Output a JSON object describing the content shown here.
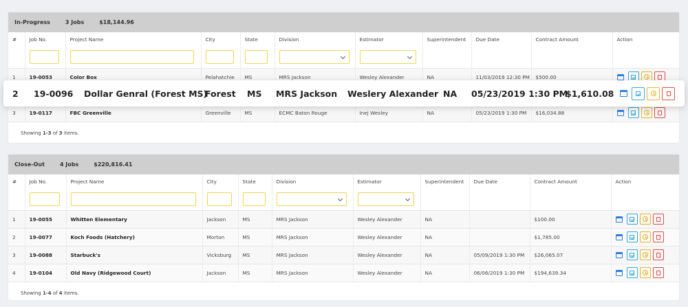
{
  "columns": [
    "#",
    "Job No.",
    "Project Name",
    "City",
    "State",
    "Division",
    "Estimator",
    "Superintendent",
    "Due Date",
    "Contract Amount",
    "Action"
  ],
  "in_progress": {
    "status": "In-Progress",
    "jobs": "3 Jobs",
    "total": "$18,144.96",
    "rows": [
      {
        "n": "1",
        "job": "19-0053",
        "project": "Color Box",
        "city": "Pelahatchie",
        "state": "MS",
        "division": "MRS Jackson",
        "estimator": "Wesley Alexander",
        "super": "NA",
        "due": "11/03/2019 12:30 PM",
        "amount": "$500.00"
      },
      {
        "n": "2",
        "job": "19-0096",
        "project": "Dollar Genral (Forest MS)",
        "city": "Forest",
        "state": "MS",
        "division": "MRS Jackson",
        "estimator": "Weslery Alexander",
        "super": "NA",
        "due": "05/23/2019 1:30 PM",
        "amount": "$1,610.08"
      },
      {
        "n": "3",
        "job": "19-0117",
        "project": "FBC Greenville",
        "city": "Greenville",
        "state": "MS",
        "division": "ECMC Baton Rouge",
        "estimator": "Inej Wesley",
        "super": "NA",
        "due": "05/23/2019 1:30 PM",
        "amount": "$16,034.88"
      }
    ],
    "showing": {
      "prefix": "Showing ",
      "range": "1-3",
      "mid": " of ",
      "count": "3",
      "suffix": " items."
    }
  },
  "close_out": {
    "status": "Close-Out",
    "jobs": "4 Jobs",
    "total": "$220,816.41",
    "rows": [
      {
        "n": "1",
        "job": "19-0055",
        "project": "Whitten Elementary",
        "city": "Jackson",
        "state": "MS",
        "division": "MRS Jackson",
        "estimator": "Wesley Alexander",
        "super": "NA",
        "due": "",
        "amount": "$100.00"
      },
      {
        "n": "2",
        "job": "19-0077",
        "project": "Koch Foods (Hatchery)",
        "city": "Morton",
        "state": "MS",
        "division": "MRS Jackson",
        "estimator": "Wesley Alexander",
        "super": "NA",
        "due": "",
        "amount": "$1,785.00"
      },
      {
        "n": "3",
        "job": "19-0088",
        "project": "Starbuck's",
        "city": "Vicksburg",
        "state": "MS",
        "division": "MRS Jackson",
        "estimator": "Wesley Alexander",
        "super": "NA",
        "due": "05/09/2019 1:30 PM",
        "amount": "$26,065.07"
      },
      {
        "n": "4",
        "job": "19-0104",
        "project": "Old Navy (Ridgewood Court)",
        "city": "Jackson",
        "state": "MS",
        "division": "MRS Jackson",
        "estimator": "Wesley Alexander",
        "super": "NA",
        "due": "06/06/2019 1:30 PM",
        "amount": "$194,639.34"
      }
    ],
    "showing": {
      "prefix": "Showing ",
      "range": "1-4",
      "mid": " of ",
      "count": "4",
      "suffix": " items."
    }
  },
  "colors": {
    "accent_border": "#f0d451",
    "calendar": "#2f7de1",
    "check": "#35a8d6",
    "clock": "#e8b324",
    "delete": "#e04b4b"
  },
  "icons": {
    "calendar": "calendar-icon",
    "check": "checklist-icon",
    "clock": "clock-icon",
    "delete": "trash-icon"
  }
}
